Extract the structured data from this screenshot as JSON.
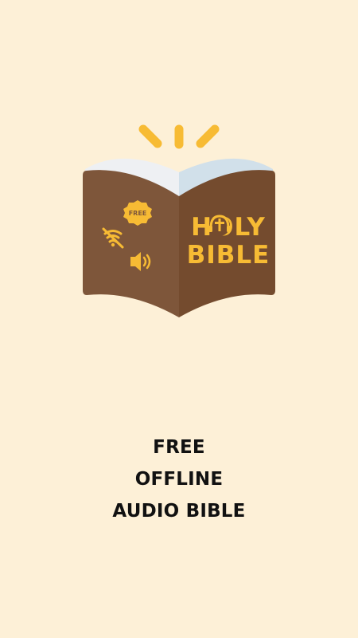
{
  "colors": {
    "background": "#fdf0d7",
    "cover_left": "#7e563a",
    "cover_right": "#744b2e",
    "accent_yellow": "#f7bb34",
    "page_white": "#eef0f3",
    "page_blue": "#d1e0ea",
    "text": "#111111"
  },
  "logo": {
    "title_line1": "HOLY",
    "title_line2": "BIBLE",
    "badge_label": "FREE",
    "icons": [
      "light-rays-icon",
      "free-badge-icon",
      "wifi-off-icon",
      "speaker-icon",
      "headphones-cross-icon"
    ]
  },
  "tagline": {
    "line1": "FREE",
    "line2": "OFFLINE",
    "line3": "AUDIO BIBLE"
  }
}
